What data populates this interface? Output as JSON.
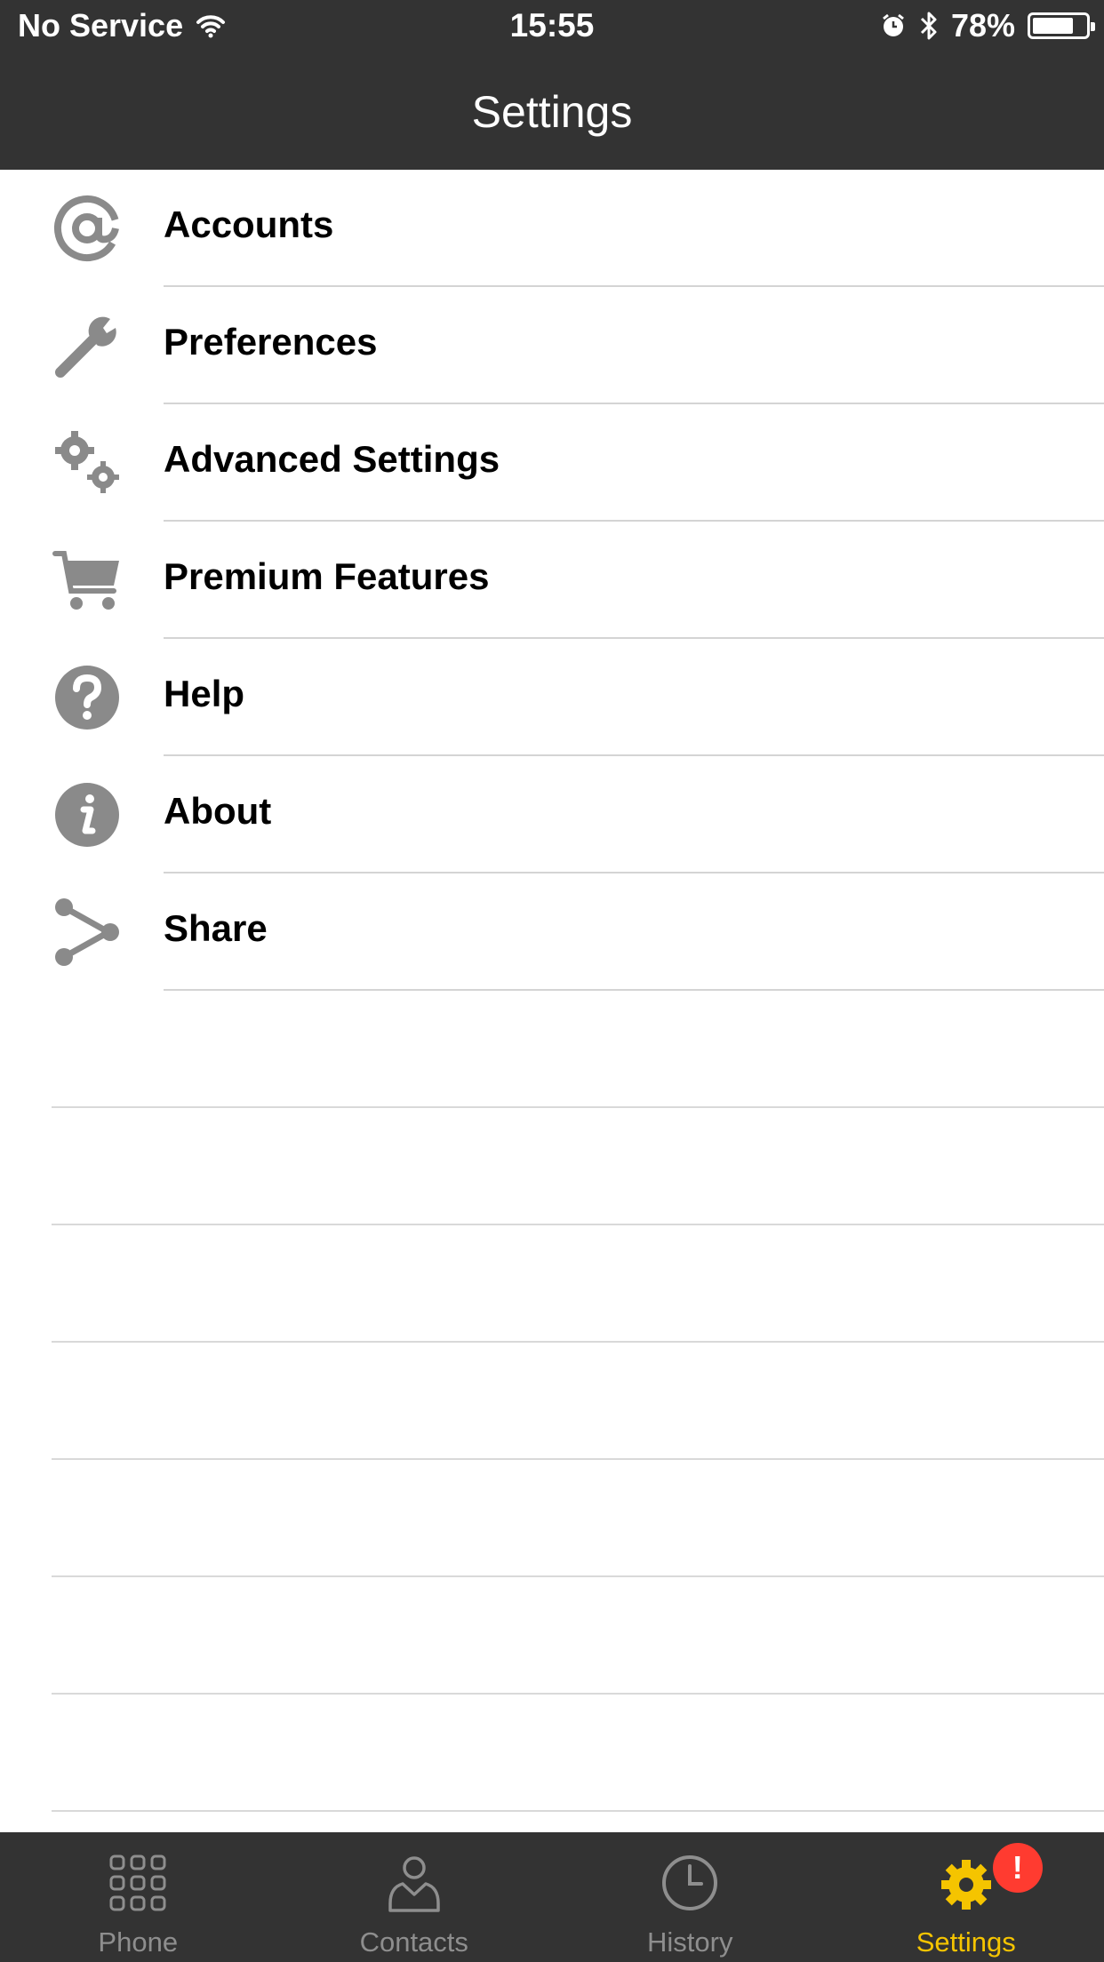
{
  "status_bar": {
    "carrier": "No Service",
    "time": "15:55",
    "battery_percent": "78%",
    "battery_level": 0.78
  },
  "nav": {
    "title": "Settings"
  },
  "settings_list": [
    {
      "label": "Accounts",
      "icon": "at-icon"
    },
    {
      "label": "Preferences",
      "icon": "wrench-icon"
    },
    {
      "label": "Advanced Settings",
      "icon": "gears-icon"
    },
    {
      "label": "Premium Features",
      "icon": "cart-icon"
    },
    {
      "label": "Help",
      "icon": "help-icon"
    },
    {
      "label": "About",
      "icon": "info-icon"
    },
    {
      "label": "Share",
      "icon": "share-icon"
    }
  ],
  "tab_bar": {
    "tabs": [
      {
        "label": "Phone",
        "icon": "keypad-icon"
      },
      {
        "label": "Contacts",
        "icon": "contact-icon"
      },
      {
        "label": "History",
        "icon": "clock-icon"
      },
      {
        "label": "Settings",
        "icon": "gear-icon",
        "active": true,
        "badge": "!"
      }
    ]
  },
  "colors": {
    "bar_background": "#333333",
    "active_tab": "#f5c400",
    "inactive_tab": "#8e8e8e",
    "badge": "#ff3b30",
    "icon_gray": "#8a8a8a"
  }
}
